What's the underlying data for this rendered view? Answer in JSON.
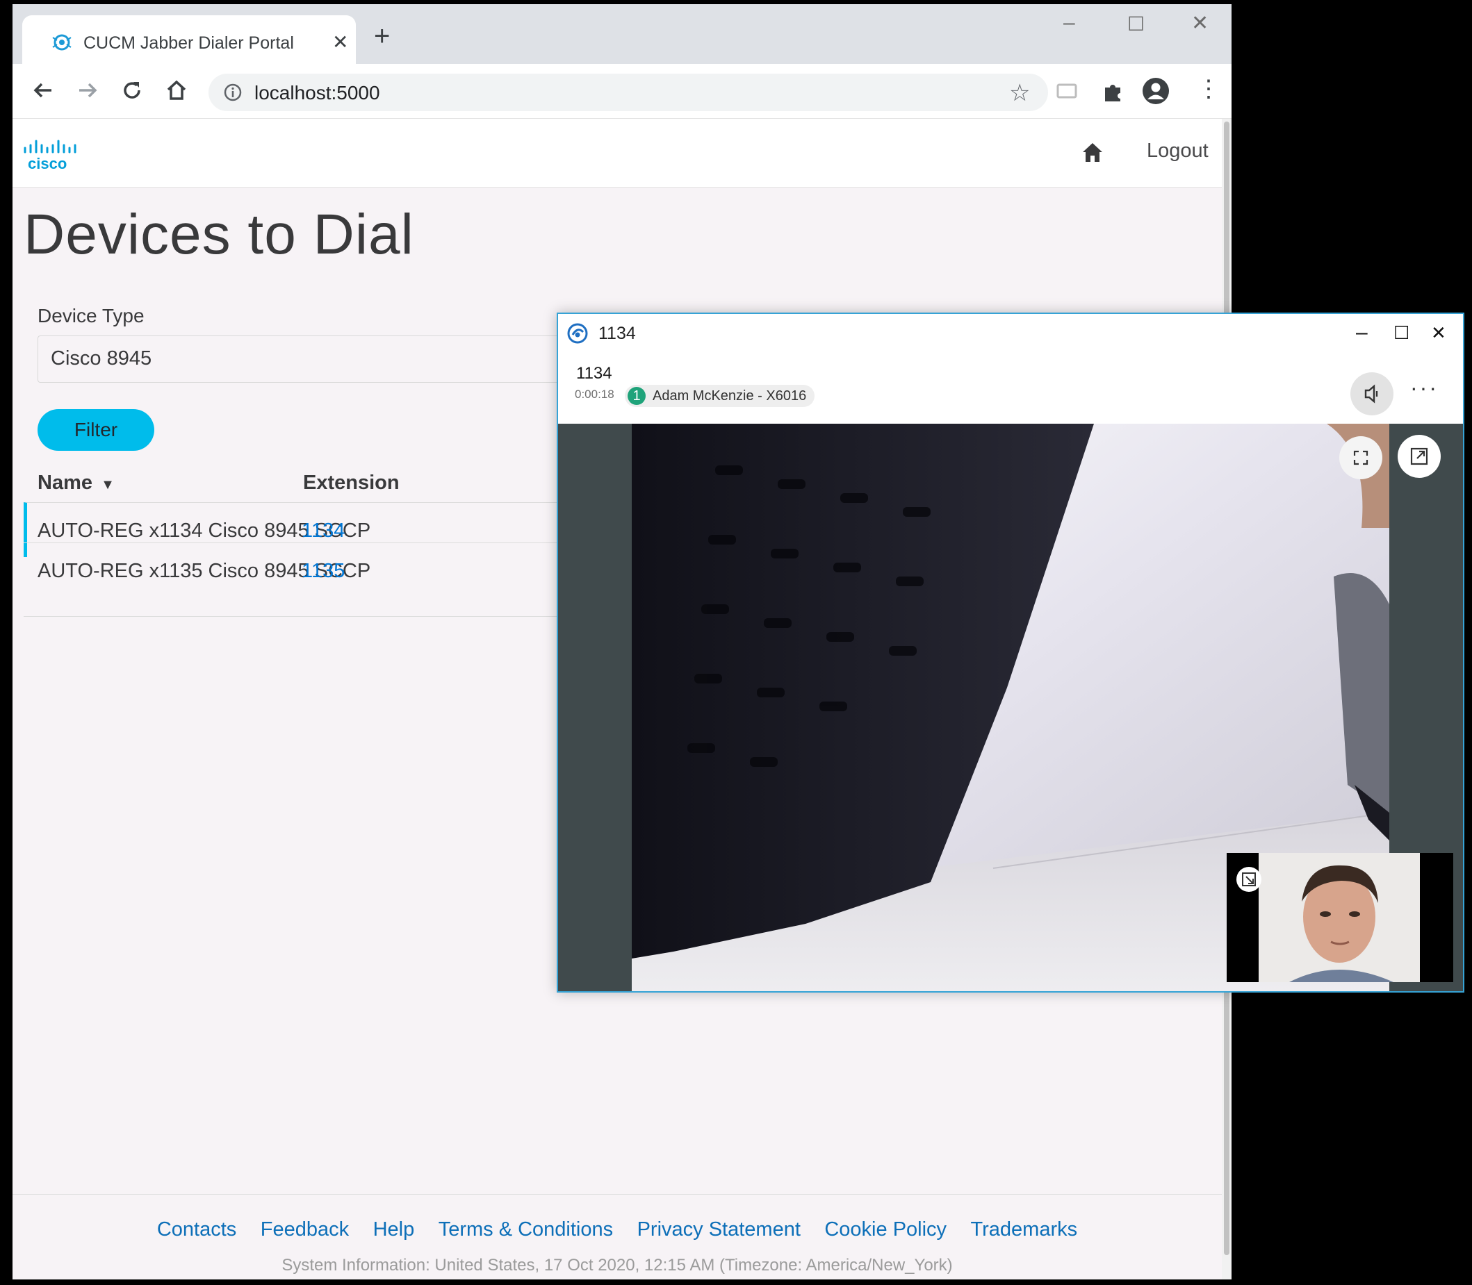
{
  "browser": {
    "tab_title": "CUCM Jabber Dialer Portal",
    "url": "localhost:5000"
  },
  "site": {
    "logo_text": "cisco",
    "logout": "Logout"
  },
  "page": {
    "title": "Devices to Dial",
    "device_type_label": "Device Type",
    "device_type_value": "Cisco 8945",
    "filter_button": "Filter",
    "table": {
      "headers": {
        "name": "Name",
        "extension": "Extension"
      },
      "rows": [
        {
          "name": "AUTO-REG x1134 Cisco 8945 SCCP",
          "extension": "1134"
        },
        {
          "name": "AUTO-REG x1135 Cisco 8945 SCCP",
          "extension": "1135"
        }
      ]
    }
  },
  "footer": {
    "links": [
      "Contacts",
      "Feedback",
      "Help",
      "Terms & Conditions",
      "Privacy Statement",
      "Cookie Policy",
      "Trademarks"
    ],
    "system_info": "System Information: United States, 17 Oct 2020, 12:15 AM (Timezone: America/New_York)"
  },
  "call": {
    "window_title": "1134",
    "number": "1134",
    "duration": "0:00:18",
    "participant_count": "1",
    "participant": "Adam McKenzie - X6016"
  },
  "colors": {
    "accent": "#00bceb",
    "link": "#0d6fb8",
    "jabber_border": "#36a3d6",
    "participant_badge": "#1fa37a"
  }
}
